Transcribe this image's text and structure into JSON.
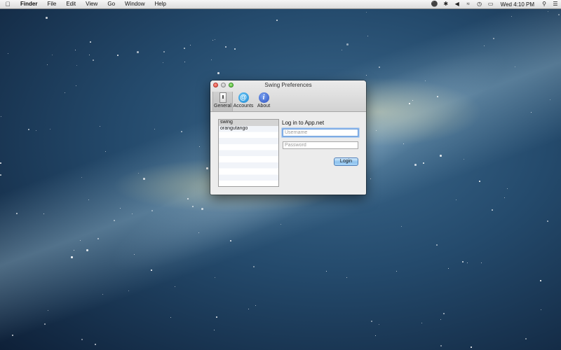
{
  "menubar": {
    "apple_icon": "apple-icon",
    "app_name": "Finder",
    "menus": [
      "File",
      "Edit",
      "View",
      "Go",
      "Window",
      "Help"
    ],
    "status_icons": [
      "accessibility-icon",
      "bluetooth-icon",
      "volume-icon",
      "wifi-icon",
      "time-machine-icon",
      "battery-icon"
    ],
    "clock": "Wed 4:10 PM",
    "spotlight_icon": "spotlight-icon",
    "notifications_icon": "notification-center-icon"
  },
  "window": {
    "title": "Swing Preferences",
    "toolbar": [
      {
        "label": "General",
        "icon": "general-icon",
        "selected": true
      },
      {
        "label": "Accounts",
        "icon": "at-icon",
        "selected": false
      },
      {
        "label": "About",
        "icon": "info-icon",
        "selected": false
      }
    ],
    "accounts": [
      "swing",
      "orangutango"
    ],
    "login": {
      "heading": "Log in to App.net",
      "username_placeholder": "Username",
      "password_placeholder": "Password",
      "button_label": "Login"
    }
  },
  "colors": {
    "accent": "#6f9fd8",
    "close": "#e0443a",
    "minimize": "#b8b8b8",
    "zoom": "#4cba33",
    "desktop": "#244a6c"
  }
}
